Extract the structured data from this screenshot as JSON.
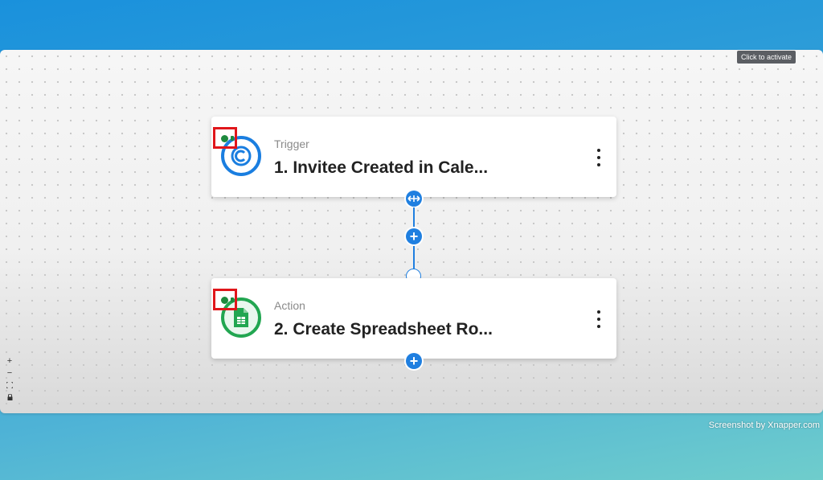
{
  "canvas": {
    "tooltip": "Click to activate"
  },
  "nodes": [
    {
      "type_label": "Trigger",
      "title": "1. Invitee Created in Cale...",
      "app_icon": "calendly-icon"
    },
    {
      "type_label": "Action",
      "title": "2. Create Spreadsheet Ro...",
      "app_icon": "google-sheets-icon"
    }
  ],
  "controls": {
    "zoom_in": "+",
    "zoom_out": "−",
    "fit": "⛶",
    "lock": "🔒"
  },
  "watermark": "Screenshot by Xnapper.com",
  "colors": {
    "accent": "#1f7fe0",
    "status_ok": "#1e8a3e",
    "highlight": "#e0161b",
    "calendly": "#1a7ee0",
    "sheets": "#22a651"
  }
}
